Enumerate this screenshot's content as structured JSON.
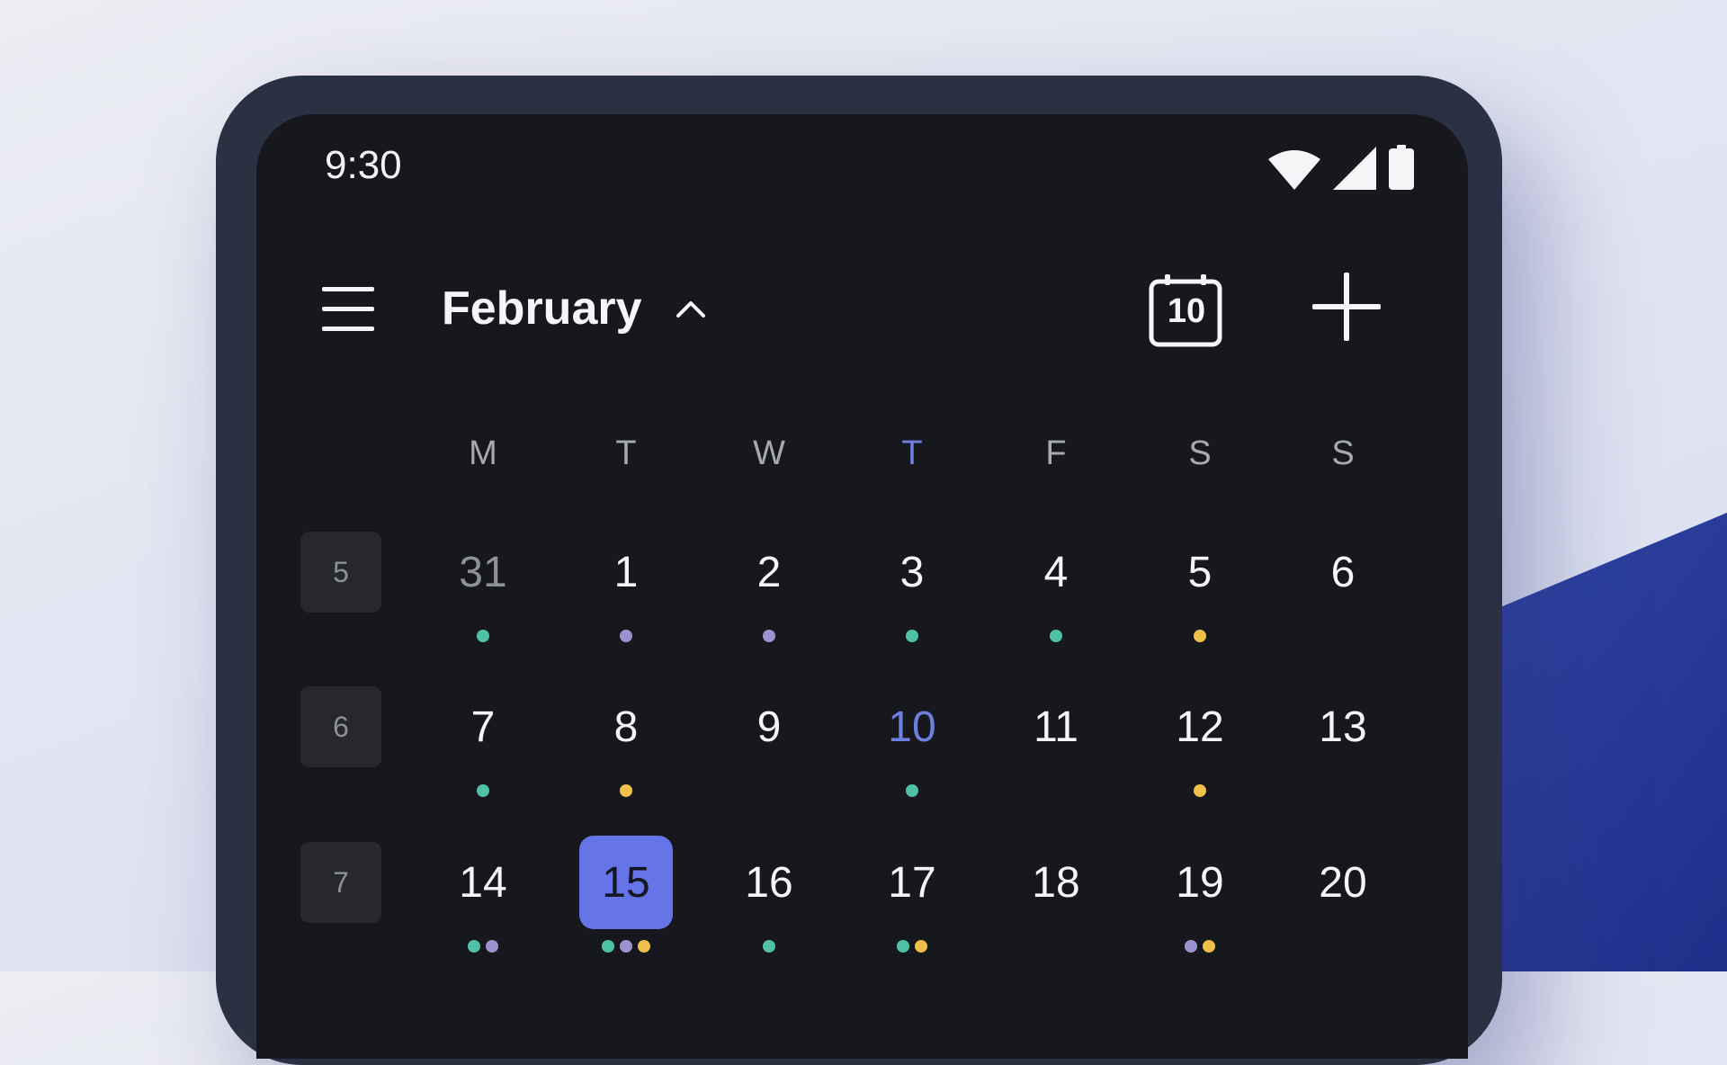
{
  "status_bar": {
    "time": "9:30",
    "icons": [
      "wifi-icon",
      "cellular-signal-icon",
      "battery-icon"
    ]
  },
  "toolbar": {
    "menu_icon": "hamburger-menu-icon",
    "month": "February",
    "expand_icon": "chevron-up-icon",
    "today_button_day": "10",
    "today_icon": "calendar-today-icon",
    "add_icon": "plus-icon"
  },
  "colors": {
    "accent": "#6574e6",
    "today_text": "#6f7fe0",
    "dot_teal": "#4fc1a6",
    "dot_purple": "#9b93cf",
    "dot_yellow": "#f0c14a"
  },
  "weekdays": [
    {
      "label": "M",
      "today": false
    },
    {
      "label": "T",
      "today": false
    },
    {
      "label": "W",
      "today": false
    },
    {
      "label": "T",
      "today": true
    },
    {
      "label": "F",
      "today": false
    },
    {
      "label": "S",
      "today": false
    },
    {
      "label": "S",
      "today": false
    }
  ],
  "weeks": [
    {
      "week_number": "5",
      "days": [
        {
          "label": "31",
          "state": "muted",
          "dots": [
            "teal"
          ]
        },
        {
          "label": "1",
          "state": "normal",
          "dots": [
            "purple"
          ]
        },
        {
          "label": "2",
          "state": "normal",
          "dots": [
            "purple"
          ]
        },
        {
          "label": "3",
          "state": "normal",
          "dots": [
            "teal"
          ]
        },
        {
          "label": "4",
          "state": "normal",
          "dots": [
            "teal"
          ]
        },
        {
          "label": "5",
          "state": "normal",
          "dots": [
            "yellow"
          ]
        },
        {
          "label": "6",
          "state": "normal",
          "dots": []
        }
      ]
    },
    {
      "week_number": "6",
      "days": [
        {
          "label": "7",
          "state": "normal",
          "dots": [
            "teal"
          ]
        },
        {
          "label": "8",
          "state": "normal",
          "dots": [
            "yellow"
          ]
        },
        {
          "label": "9",
          "state": "normal",
          "dots": []
        },
        {
          "label": "10",
          "state": "today",
          "dots": [
            "teal"
          ]
        },
        {
          "label": "11",
          "state": "normal",
          "dots": []
        },
        {
          "label": "12",
          "state": "normal",
          "dots": [
            "yellow"
          ]
        },
        {
          "label": "13",
          "state": "normal",
          "dots": []
        }
      ]
    },
    {
      "week_number": "7",
      "days": [
        {
          "label": "14",
          "state": "normal",
          "dots": [
            "teal",
            "purple"
          ]
        },
        {
          "label": "15",
          "state": "selected",
          "dots": [
            "teal",
            "purple",
            "yellow"
          ]
        },
        {
          "label": "16",
          "state": "normal",
          "dots": [
            "teal"
          ]
        },
        {
          "label": "17",
          "state": "normal",
          "dots": [
            "teal",
            "yellow"
          ]
        },
        {
          "label": "18",
          "state": "normal",
          "dots": []
        },
        {
          "label": "19",
          "state": "normal",
          "dots": [
            "purple",
            "yellow"
          ]
        },
        {
          "label": "20",
          "state": "normal",
          "dots": []
        }
      ]
    }
  ]
}
